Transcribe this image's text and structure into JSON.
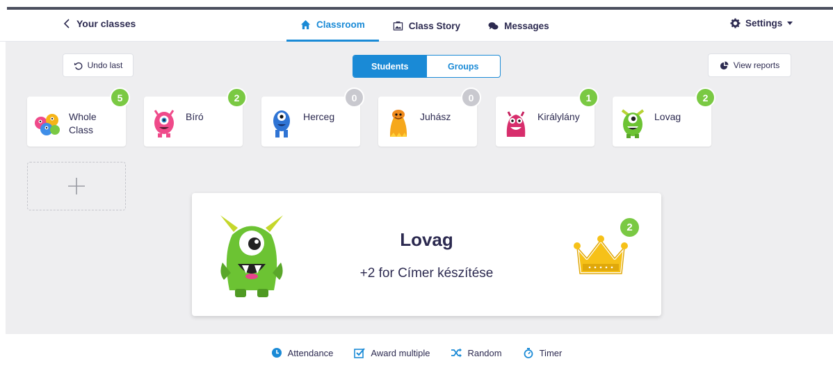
{
  "nav": {
    "back_label": "Your classes",
    "tabs": [
      {
        "label": "Classroom",
        "icon": "home-icon",
        "active": true
      },
      {
        "label": "Class Story",
        "icon": "image-icon",
        "active": false
      },
      {
        "label": "Messages",
        "icon": "chat-icon",
        "active": false
      }
    ],
    "settings_label": "Settings"
  },
  "controls": {
    "undo_label": "Undo last",
    "view_reports_label": "View reports",
    "segment": [
      "Students",
      "Groups"
    ],
    "segment_active": "Students"
  },
  "students": [
    {
      "name": "Whole Class",
      "points": "5",
      "badge_color": "green"
    },
    {
      "name": "Bíró",
      "points": "2",
      "badge_color": "green"
    },
    {
      "name": "Herceg",
      "points": "0",
      "badge_color": "grey"
    },
    {
      "name": "Juhász",
      "points": "0",
      "badge_color": "grey"
    },
    {
      "name": "Királylány",
      "points": "1",
      "badge_color": "green"
    },
    {
      "name": "Lovag",
      "points": "2",
      "badge_color": "green"
    }
  ],
  "award": {
    "name": "Lovag",
    "message": "+2 for Címer készítése",
    "points": "2"
  },
  "toolbar": [
    {
      "label": "Attendance",
      "icon": "clock-icon"
    },
    {
      "label": "Award multiple",
      "icon": "checkbox-icon"
    },
    {
      "label": "Random",
      "icon": "shuffle-icon"
    },
    {
      "label": "Timer",
      "icon": "stopwatch-icon"
    }
  ],
  "colors": {
    "accent": "#1a8ad6",
    "badge_green": "#7ac943",
    "badge_grey": "#c9c9cf",
    "board": "#eeeef0"
  }
}
